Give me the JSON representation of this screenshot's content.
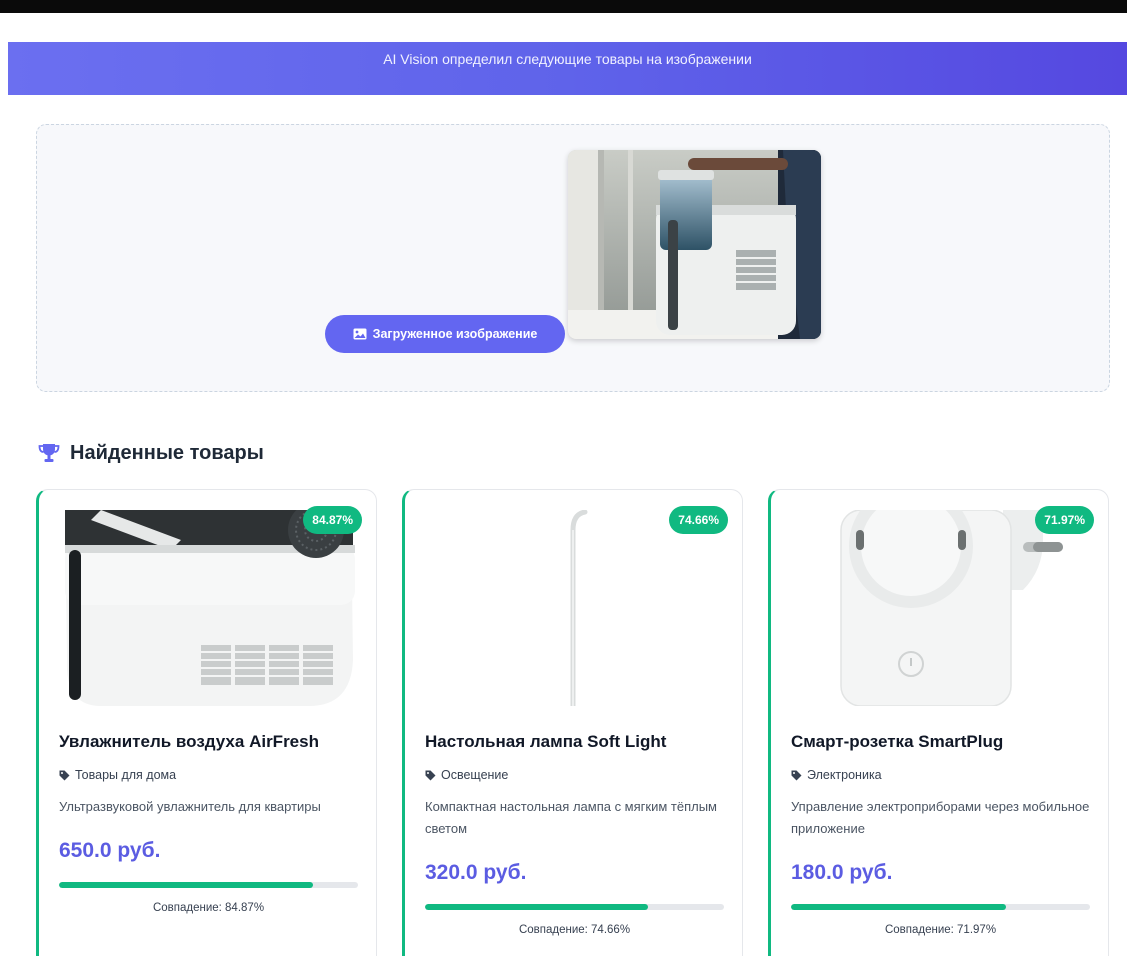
{
  "header": {
    "subtitle": "AI Vision определил следующие товары на изображении"
  },
  "upload": {
    "badge_label": "Загруженное изображение",
    "badge_icon": "image-icon"
  },
  "results": {
    "title": "Найденные товары",
    "title_icon": "trophy-icon",
    "products": [
      {
        "name": "Увлажнитель воздуха AirFresh",
        "category": "Товары для дома",
        "description": "Ультразвуковой увлажнитель для квартиры",
        "price": "650.0 руб.",
        "match_badge": "84.87%",
        "match_fraction": 0.8487,
        "match_label": "Совпадение: 84.87%"
      },
      {
        "name": "Настольная лампа Soft Light",
        "category": "Освещение",
        "description": "Компактная настольная лампа с мягким тёплым светом",
        "price": "320.0 руб.",
        "match_badge": "74.66%",
        "match_fraction": 0.7466,
        "match_label": "Совпадение: 74.66%"
      },
      {
        "name": "Смарт-розетка SmartPlug",
        "category": "Электроника",
        "description": "Управление электроприборами через мобильное приложение",
        "price": "180.0 руб.",
        "match_badge": "71.97%",
        "match_fraction": 0.7197,
        "match_label": "Совпадение: 71.97%"
      }
    ]
  },
  "colors": {
    "accent": "#6366f1",
    "match_green": "#10b981",
    "price": "#5b5ce2"
  }
}
